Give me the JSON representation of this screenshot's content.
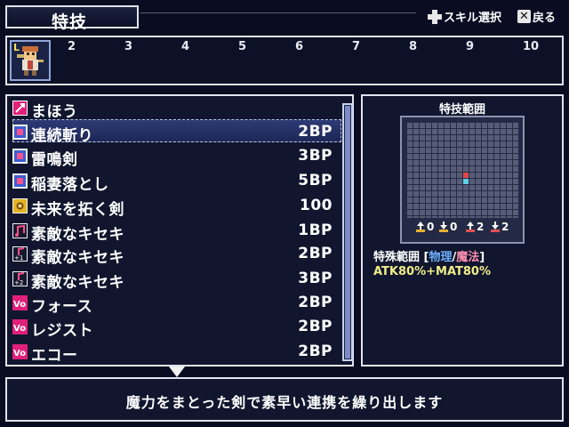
{
  "header": {
    "title": "特技",
    "hint_select": "スキル選択",
    "hint_back": "戻る"
  },
  "party": {
    "level_label": "L",
    "slots": [
      "2",
      "3",
      "4",
      "5",
      "6",
      "7",
      "8",
      "9",
      "10"
    ]
  },
  "skills": [
    {
      "icon": "magic-category-icon",
      "name": "まほう",
      "cost": ""
    },
    {
      "icon": "sword-skill-icon",
      "name": "連続斬り",
      "cost": "2BP",
      "selected": true
    },
    {
      "icon": "sword-skill-icon",
      "name": "雷鳴剣",
      "cost": "3BP"
    },
    {
      "icon": "sword-skill-icon",
      "name": "稲妻落とし",
      "cost": "5BP"
    },
    {
      "icon": "sparkle-skill-icon",
      "name": "未来を拓く剣",
      "cost": "100"
    },
    {
      "icon": "note-skill-icon",
      "name": "素敵なキセキ",
      "cost": "1BP"
    },
    {
      "icon": "note-plus1-skill-icon",
      "name": "素敵なキセキ",
      "cost": "2BP"
    },
    {
      "icon": "note-plus2-skill-icon",
      "name": "素敵なキセキ",
      "cost": "3BP"
    },
    {
      "icon": "vo-skill-icon",
      "name": "フォース",
      "cost": "2BP"
    },
    {
      "icon": "vo-skill-icon",
      "name": "レジスト",
      "cost": "2BP"
    },
    {
      "icon": "vo-skill-icon",
      "name": "エコー",
      "cost": "2BP"
    }
  ],
  "range": {
    "title": "特技範囲",
    "stats": [
      "0",
      "0",
      "2",
      "2"
    ],
    "type_label": "特殊範囲",
    "type_physical": "物理",
    "type_slash": "/",
    "type_magic": "魔法",
    "formula": "ATK80%+MAT80%"
  },
  "description": "魔力をまとった剣で素早い連携を繰り出します",
  "colors": {
    "physical": "#6fb0ff",
    "magic": "#ff8fb0",
    "formula": "#f0ec8a",
    "grid_target": "#e04848",
    "grid_user": "#5fd0e0"
  }
}
